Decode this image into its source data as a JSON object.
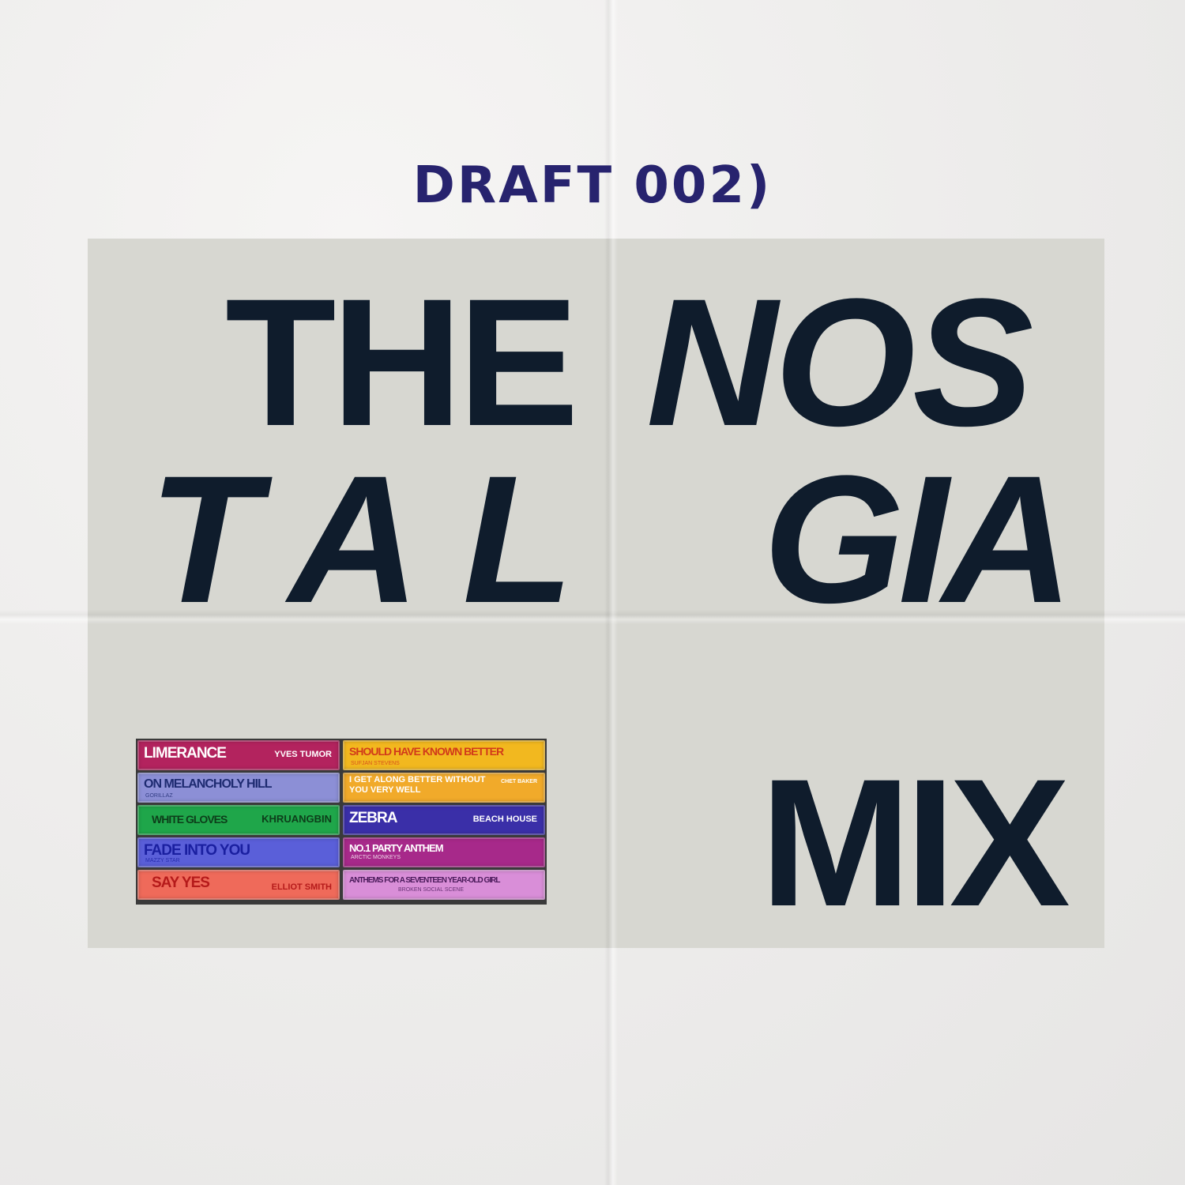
{
  "header": {
    "draft_label": "DRAFT 002)"
  },
  "title": {
    "word_the": "THE",
    "word_nos": "NOS",
    "word_tal": "TAL",
    "word_gia": "GIA",
    "word_mix": "MIX"
  },
  "colors": {
    "ink": "#0f1c2c",
    "draft": "#27236e",
    "panel": "#d7d7d1"
  },
  "cassettes": {
    "left": [
      {
        "title": "LIMERANCE",
        "artist": "YVES TUMOR",
        "color": "#b3235e",
        "text": "#ffffff"
      },
      {
        "title": "ON MELANCHOLY HILL",
        "artist": "GORILLAZ",
        "color": "#8c8fd6",
        "text": "#1d2a70"
      },
      {
        "title": "WHITE GLOVES",
        "artist": "KHRUANGBIN",
        "color": "#1fa64a",
        "text": "#0d3d1a"
      },
      {
        "title": "FADE INTO YOU",
        "artist": "MAZZY STAR",
        "color": "#5a5fd9",
        "text": "#1a1fa0"
      },
      {
        "title": "SAY YES",
        "artist": "ELLIOT SMITH",
        "color": "#ef6a5a",
        "text": "#b51a1a"
      }
    ],
    "right": [
      {
        "title": "SHOULD HAVE KNOWN BETTER",
        "artist": "SUFJAN STEVENS",
        "color": "#f2b81f",
        "text": "#d13a1a"
      },
      {
        "title": "I GET ALONG BETTER WITHOUT",
        "title2": "YOU VERY WELL",
        "artist": "CHET BAKER",
        "color": "#f1aa2a",
        "text": "#ffffff"
      },
      {
        "title": "ZEBRA",
        "artist": "BEACH HOUSE",
        "color": "#3a2fa8",
        "text": "#ffffff"
      },
      {
        "title": "NO.1 PARTY ANTHEM",
        "artist": "ARCTIC MONKEYS",
        "color": "#a7298a",
        "text": "#ffffff"
      },
      {
        "title": "ANTHEMS FOR A SEVENTEEN YEAR-OLD GIRL",
        "artist": "BROKEN SOCIAL SCENE",
        "color": "#d98ed8",
        "text": "#4a1a5a"
      }
    ]
  }
}
